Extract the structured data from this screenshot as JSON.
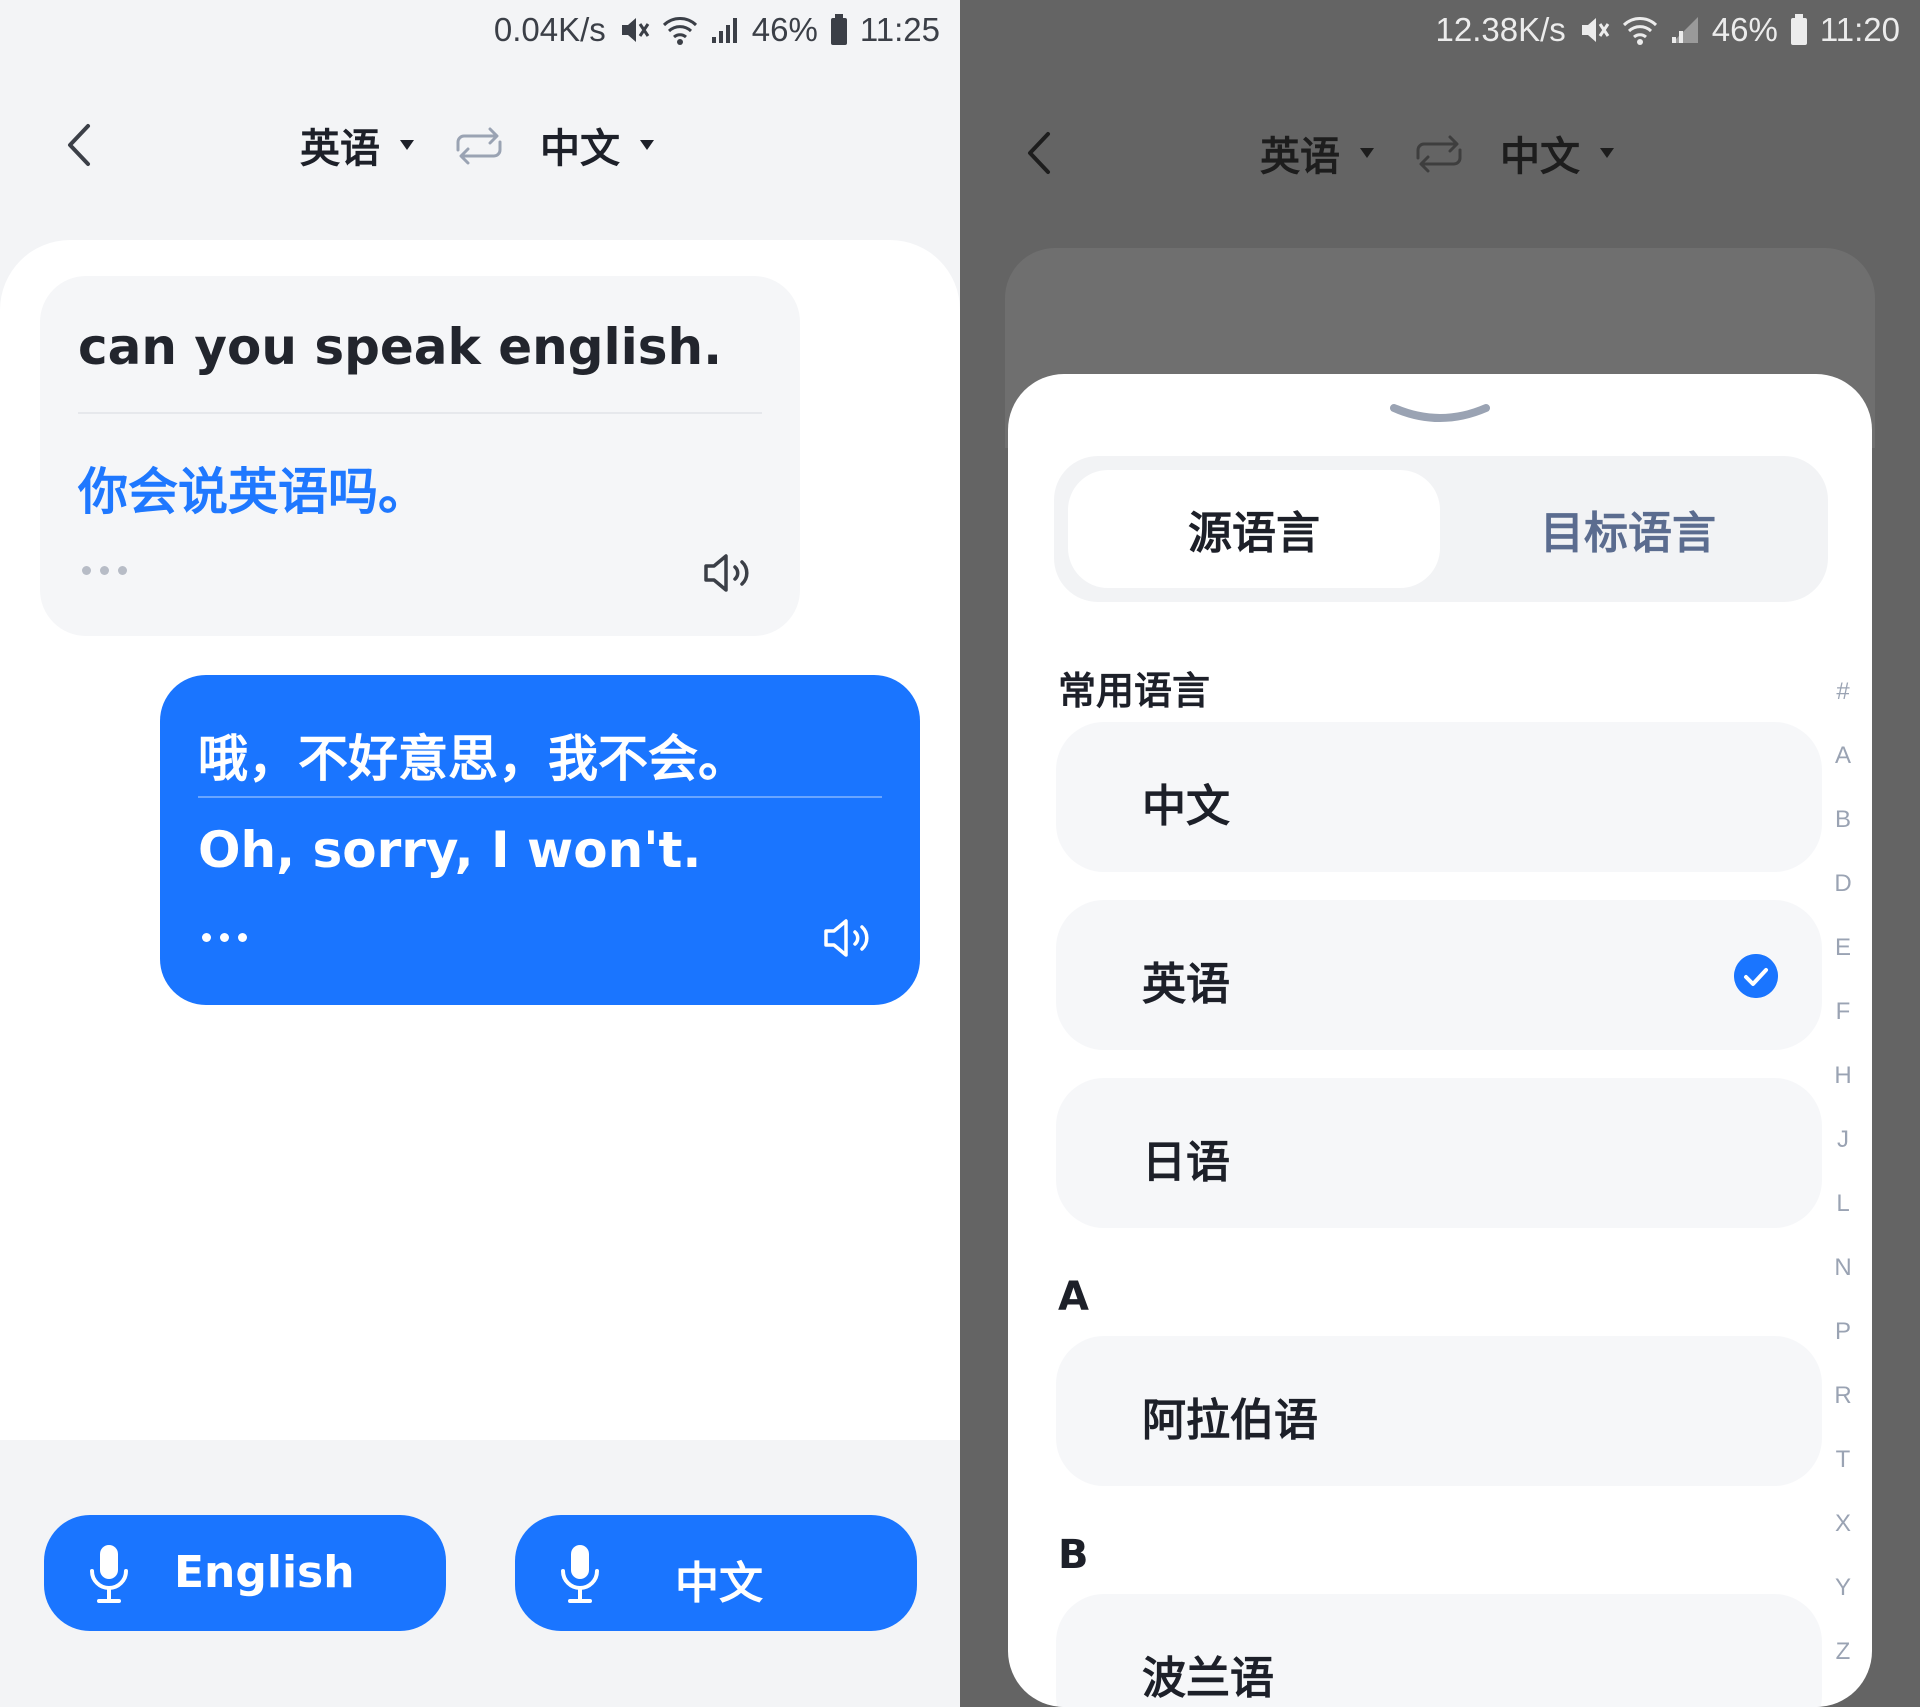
{
  "colors": {
    "accent": "#1a75ff",
    "accent_text": "#1f78ff",
    "inactive_tab": "#5b6c8f",
    "overlay": "#646464"
  },
  "left": {
    "status": {
      "speed": "0.04K/s",
      "battery": "46%",
      "time": "11:25"
    },
    "header": {
      "source_lang": "英语",
      "target_lang": "中文"
    },
    "messages": [
      {
        "source": "can you speak english.",
        "translation": "你会说英语吗。"
      },
      {
        "source": "哦，不好意思，我不会。",
        "translation": "Oh, sorry, I won't."
      }
    ],
    "buttons": {
      "mic_english": "English",
      "mic_chinese": "中文"
    }
  },
  "right": {
    "status": {
      "speed": "12.38K/s",
      "battery": "46%",
      "time": "11:20"
    },
    "header": {
      "source_lang": "英语",
      "target_lang": "中文"
    },
    "sheet": {
      "tabs": {
        "source": "源语言",
        "target": "目标语言"
      },
      "common_label": "常用语言",
      "common": [
        {
          "name": "中文",
          "selected": false
        },
        {
          "name": "英语",
          "selected": true
        },
        {
          "name": "日语",
          "selected": false
        }
      ],
      "sections": [
        {
          "letter": "A",
          "items": [
            "阿拉伯语"
          ]
        },
        {
          "letter": "B",
          "items": [
            "波兰语"
          ]
        }
      ],
      "index": [
        "#",
        "A",
        "B",
        "D",
        "E",
        "F",
        "H",
        "J",
        "L",
        "N",
        "P",
        "R",
        "T",
        "X",
        "Y",
        "Z"
      ]
    }
  }
}
